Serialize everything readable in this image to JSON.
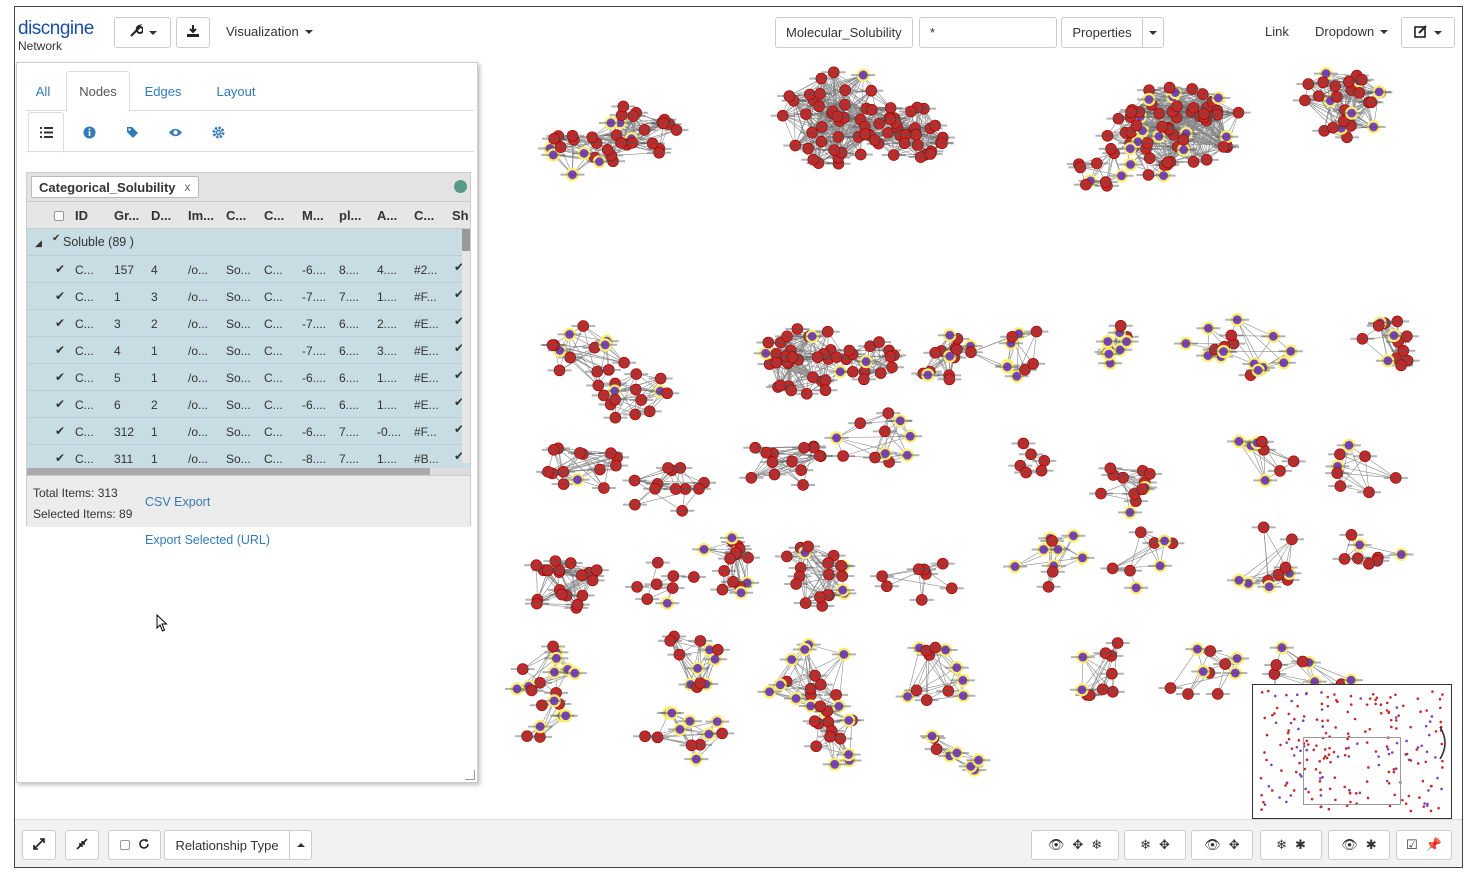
{
  "app": {
    "brand": "discngine",
    "brand_sub": "Network"
  },
  "toolbar": {
    "visualization_label": "Visualization",
    "dataset_value": "Molecular_Solubility",
    "filter_value": "*",
    "properties_label": "Properties",
    "link_label": "Link",
    "dropdown_label": "Dropdown"
  },
  "panel": {
    "tabs": [
      {
        "label": "All"
      },
      {
        "label": "Nodes"
      },
      {
        "label": "Edges"
      },
      {
        "label": "Layout"
      }
    ],
    "subtab_icons": [
      "list-icon",
      "info-icon",
      "tag-icon",
      "eye-icon",
      "gear-icon"
    ],
    "group_by_chip": "Categorical_Solubility",
    "group_by_close": "x",
    "columns": [
      "ID",
      "Gr...",
      "D...",
      "Im...",
      "C...",
      "C...",
      "M...",
      "pl...",
      "A...",
      "C...",
      "Sh"
    ],
    "group": {
      "label": "Soluble (89 )"
    },
    "rows": [
      [
        "C...",
        "157",
        "4",
        "/o...",
        "So...",
        "C...",
        "-6....",
        "8....",
        "4....",
        "#2..."
      ],
      [
        "C...",
        "1",
        "3",
        "/o...",
        "So...",
        "C...",
        "-7....",
        "7....",
        "1....",
        "#F..."
      ],
      [
        "C...",
        "3",
        "2",
        "/o...",
        "So...",
        "C...",
        "-7....",
        "6....",
        "2....",
        "#E..."
      ],
      [
        "C...",
        "4",
        "1",
        "/o...",
        "So...",
        "C...",
        "-7....",
        "6....",
        "3....",
        "#E..."
      ],
      [
        "C...",
        "5",
        "1",
        "/o...",
        "So...",
        "C...",
        "-6....",
        "6....",
        "1....",
        "#E..."
      ],
      [
        "C...",
        "6",
        "2",
        "/o...",
        "So...",
        "C...",
        "-6....",
        "6....",
        "1....",
        "#E..."
      ],
      [
        "C...",
        "312",
        "1",
        "/o...",
        "So...",
        "C...",
        "-6....",
        "7....",
        "-0....",
        "#F..."
      ],
      [
        "C...",
        "311",
        "1",
        "/o...",
        "So...",
        "C...",
        "-8....",
        "7....",
        "1....",
        "#B..."
      ]
    ],
    "total_items": "Total Items: 313",
    "selected_items": "Selected Items: 89",
    "csv_export": "CSV Export",
    "export_selected": "Export Selected (URL)"
  },
  "bottom": {
    "relationship_type": "Relationship Type"
  },
  "colors": {
    "node_red": "#c62828",
    "node_purple": "#7b3fc0",
    "node_highlight": "#f5f066",
    "edge": "#8a8a8a",
    "link": "#337ab7",
    "brand": "#1a4fa3"
  }
}
